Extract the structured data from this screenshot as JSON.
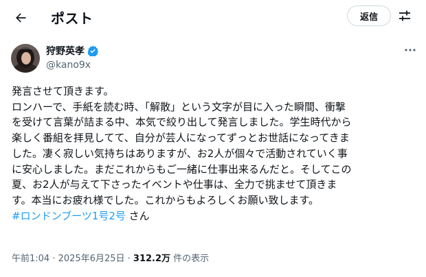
{
  "header": {
    "title": "ポスト",
    "reply_label": "返信"
  },
  "author": {
    "display_name": "狩野英孝",
    "handle": "@kano9x",
    "verified": true
  },
  "post": {
    "lines": [
      "発言させて頂きます。",
      "ロンハーで、手紙を読む時、「解散」という文字が目に入った瞬間、衝撃",
      "を受けて言葉が詰まる中、本気で絞り出して発言しました。学生時代から",
      "楽しく番組を拝見してて、自分が芸人になってずっとお世話になってきま",
      "した。凄く寂しい気持ちはありますが、お2人が個々で活動されていく事",
      "に安心しました。まだこれからもご一緒に仕事出来るんだと。そしてこの",
      "夏、お2人が与えて下さったイベントや仕事は、全力で挑ませて頂きま",
      "す。本当にお疲れ様でした。これからもよろしくお願い致します。"
    ],
    "hashtag": "#ロンドンブーツ1号2号",
    "hashtag_suffix": " さん"
  },
  "meta": {
    "time": "午前1:04",
    "separator1": " · ",
    "date": "2025年6月25日",
    "separator2": " · ",
    "views_count": "312.2万",
    "views_label": " 件の表示"
  },
  "colors": {
    "accent": "#1d9bf0",
    "text": "#0f1419",
    "secondary": "#536471"
  },
  "icons": {
    "back": "arrow-left-icon",
    "filter": "sliders-icon",
    "verified": "verified-badge-icon",
    "more": "more-horizontal-icon"
  }
}
